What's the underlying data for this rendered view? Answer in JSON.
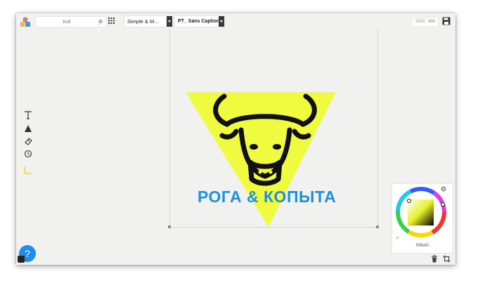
{
  "search": {
    "placeholder": "bull"
  },
  "toolbar": {
    "font_style": "Simple & M...",
    "font_family": "PT_ Sans Caption",
    "resolution": "1920 : 866"
  },
  "canvas": {
    "brand_text": "РОГА & КОПЫТА",
    "triangle_color": "#f0fb40",
    "text_color": "#1f8fe0"
  },
  "color_picker": {
    "hex": "f0fb40"
  },
  "help": {
    "label": "?"
  },
  "icons": [
    "app-logo-icon",
    "search-icon",
    "grid-icon",
    "save-icon",
    "text-tool-icon",
    "shape-tool-icon",
    "sticker-tool-icon",
    "history-tool-icon",
    "corner-tool-icon",
    "close-icon",
    "eyedropper-icon",
    "trash-icon",
    "crop-icon"
  ]
}
